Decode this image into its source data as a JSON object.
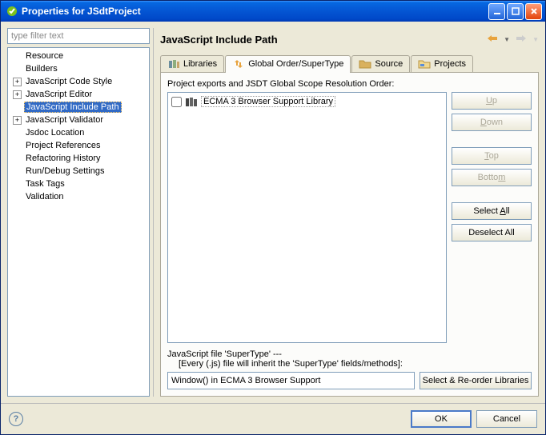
{
  "window": {
    "title": "Properties for JSdtProject"
  },
  "sidebar": {
    "filter_placeholder": "type filter text",
    "items": [
      {
        "label": "Resource",
        "expandable": false
      },
      {
        "label": "Builders",
        "expandable": false
      },
      {
        "label": "JavaScript Code Style",
        "expandable": true
      },
      {
        "label": "JavaScript Editor",
        "expandable": true
      },
      {
        "label": "JavaScript Include Path",
        "expandable": false,
        "selected": true
      },
      {
        "label": "JavaScript Validator",
        "expandable": true
      },
      {
        "label": "Jsdoc Location",
        "expandable": false
      },
      {
        "label": "Project References",
        "expandable": false
      },
      {
        "label": "Refactoring History",
        "expandable": false
      },
      {
        "label": "Run/Debug Settings",
        "expandable": false
      },
      {
        "label": "Task Tags",
        "expandable": false
      },
      {
        "label": "Validation",
        "expandable": false
      }
    ]
  },
  "main": {
    "title": "JavaScript Include Path",
    "tabs": [
      {
        "label": "Libraries"
      },
      {
        "label": "Global Order/SuperType",
        "active": true
      },
      {
        "label": "Source"
      },
      {
        "label": "Projects"
      }
    ],
    "order_label": "Project exports and JSDT Global Scope Resolution Order:",
    "list": [
      {
        "label": "ECMA 3 Browser Support Library",
        "checked": false
      }
    ],
    "buttons": {
      "up": "Up",
      "down": "Down",
      "top": "Top",
      "bottom": "Bottom",
      "select_all": "Select All",
      "deselect_all": "Deselect All"
    },
    "supertype": {
      "label_line1": "JavaScript file 'SuperType'  ---",
      "label_line2": "[Every (.js) file will inherit the 'SuperType' fields/methods]:",
      "value": "Window() in ECMA 3 Browser Support",
      "button": "Select & Re-order Libraries"
    }
  },
  "footer": {
    "ok": "OK",
    "cancel": "Cancel"
  }
}
